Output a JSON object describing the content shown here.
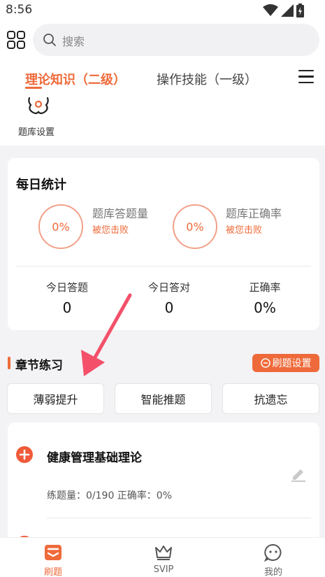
{
  "status": {
    "time": "8:56"
  },
  "search": {
    "placeholder": "搜索"
  },
  "tabs": [
    {
      "label": "理论知识（二级）",
      "active": true
    },
    {
      "label": "操作技能（一级）",
      "active": false
    }
  ],
  "bank_settings": {
    "label": "题库设置"
  },
  "daily": {
    "title": "每日统计",
    "stats": [
      {
        "percent": "0%",
        "label": "题库答题量",
        "sub": "被您击败"
      },
      {
        "percent": "0%",
        "label": "题库正确率",
        "sub": "被您击败"
      }
    ],
    "today": [
      {
        "label": "今日答题",
        "value": "0"
      },
      {
        "label": "今日答对",
        "value": "0"
      },
      {
        "label": "正确率",
        "value": "0%"
      }
    ]
  },
  "chapter": {
    "title": "章节练习",
    "settings_label": "刷题设置",
    "modes": [
      "薄弱提升",
      "智能推题",
      "抗遗忘"
    ],
    "items": [
      {
        "name": "健康管理基础理论",
        "meta": "练题量：0/190   正确率：0%"
      }
    ]
  },
  "nav": [
    {
      "label": "刷题",
      "active": true
    },
    {
      "label": "SVIP",
      "active": false
    },
    {
      "label": "我的",
      "active": false
    }
  ],
  "colors": {
    "accent": "#ef6a3a",
    "ring": "#f2a189",
    "arrow": "#f4506a"
  }
}
